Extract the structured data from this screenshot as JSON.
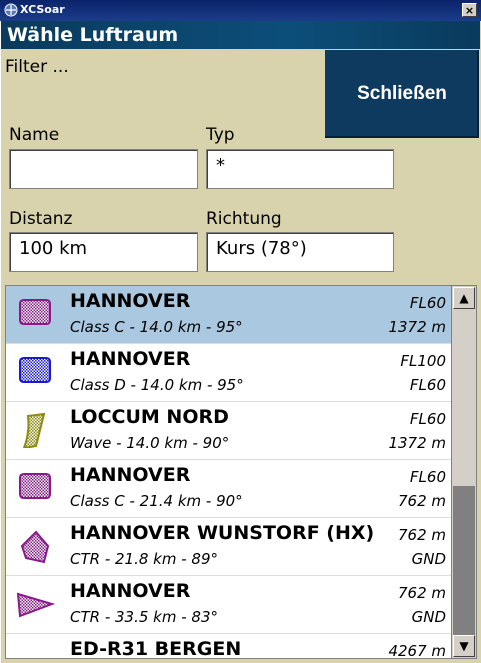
{
  "window": {
    "title": "XCSoar"
  },
  "dialog": {
    "caption": "Wähle Luftraum",
    "filter_label": "Filter ...",
    "close_label": "Schließen",
    "name_label": "Name",
    "name_value": "",
    "type_label": "Typ",
    "type_value": "*",
    "distance_label": "Distanz",
    "distance_value": "100 km",
    "direction_label": "Richtung",
    "direction_value": "Kurs (78°)"
  },
  "airspaces": [
    {
      "name": "HANNOVER",
      "detail": "Class C - 14.0 km - 95°",
      "top": "FL60",
      "base": "1372 m",
      "shape": "rounded",
      "color": "#8a1a8a",
      "selected": true
    },
    {
      "name": "HANNOVER",
      "detail": "Class D - 14.0 km - 95°",
      "top": "FL100",
      "base": "FL60",
      "shape": "rounded",
      "color": "#1a1ad0",
      "selected": false
    },
    {
      "name": "LOCCUM NORD",
      "detail": "Wave - 14.0 km - 90°",
      "top": "FL60",
      "base": "1372 m",
      "shape": "wave",
      "color": "#8a8a10",
      "selected": false
    },
    {
      "name": "HANNOVER",
      "detail": "Class C - 21.4 km - 90°",
      "top": "FL60",
      "base": "762 m",
      "shape": "rounded",
      "color": "#8a1a8a",
      "selected": false
    },
    {
      "name": "HANNOVER WUNSTORF (HX)",
      "detail": "CTR - 21.8 km - 89°",
      "top": "762 m",
      "base": "GND",
      "shape": "ctr1",
      "color": "#8a1a8a",
      "selected": false
    },
    {
      "name": "HANNOVER",
      "detail": "CTR - 33.5 km - 83°",
      "top": "762 m",
      "base": "GND",
      "shape": "ctr2",
      "color": "#8a1a8a",
      "selected": false
    },
    {
      "name": "ED-R31 BERGEN",
      "detail": "",
      "top": "4267 m",
      "base": "",
      "shape": "restricted",
      "color": "#e02020",
      "selected": false
    }
  ],
  "icons": {
    "window": "app-icon",
    "close": "close-icon",
    "scroll_up": "arrow-up-icon",
    "scroll_down": "arrow-down-icon"
  }
}
